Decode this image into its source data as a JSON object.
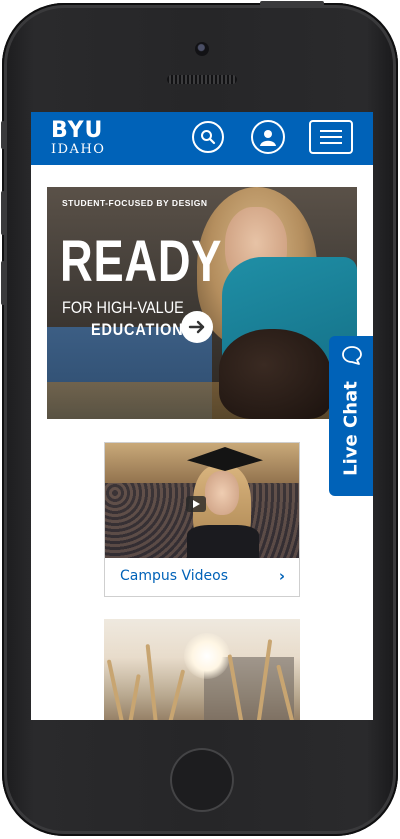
{
  "header": {
    "logo_top": "BYU",
    "logo_bottom": "IDAHO",
    "icons": [
      "search-icon",
      "user-icon",
      "menu-icon"
    ],
    "brand_color": "#0062b8"
  },
  "hero": {
    "tagline": "STUDENT-FOCUSED BY DESIGN",
    "headline": "READY",
    "line1": "FOR HIGH-VALUE",
    "line2": "EDUCATION",
    "arrow_icon": "arrow-right-icon"
  },
  "live_chat": {
    "label": "Live Chat",
    "icon": "chat-bubble-icon"
  },
  "cards": [
    {
      "label": "Campus Videos",
      "icon": "chevron-right-icon",
      "has_play": true
    },
    {
      "label": ""
    }
  ],
  "chevron_glyph": "›"
}
